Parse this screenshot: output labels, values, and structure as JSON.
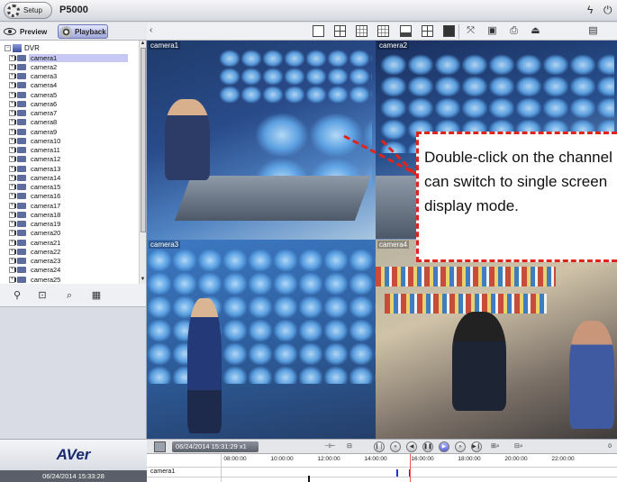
{
  "app": {
    "setup_label": "Setup",
    "title": "P5000",
    "title_icons": [
      "lightning-icon",
      "power-icon"
    ]
  },
  "modes": {
    "preview_label": "Preview",
    "playback_label": "Playback",
    "active": "Playback"
  },
  "toolbar": {
    "collapse_symbol": "‹",
    "tools": [
      "single-view",
      "quad-view",
      "nine-view",
      "sixteen-view",
      "one-plus-five-view",
      "one-plus-seven-view",
      "twenty-five-view",
      "fullscreen",
      "snapshot",
      "print",
      "backup",
      "exit"
    ]
  },
  "tree": {
    "root": "DVR",
    "selected": "camera1",
    "cameras": [
      "camera1",
      "camera2",
      "camera3",
      "camera4",
      "camera5",
      "camera6",
      "camera7",
      "camera8",
      "camera9",
      "camera10",
      "camera11",
      "camera12",
      "camera13",
      "camera14",
      "camera15",
      "camera16",
      "camera17",
      "camera18",
      "camera19",
      "camera20",
      "camera21",
      "camera22",
      "camera23",
      "camera24",
      "camera25"
    ]
  },
  "tree_tools": [
    "connect-icon",
    "export-icon",
    "search-icon",
    "playback-list-icon"
  ],
  "video": {
    "tiles": [
      "camera1",
      "camera2",
      "camera3",
      "camera4"
    ]
  },
  "callout": {
    "text": "Double-click on the channel can switch to single screen display mode.",
    "border_color": "#e0241b"
  },
  "playback": {
    "datetime": "06/24/2014 15:31:29 x1",
    "buttons": [
      "rewind-fast",
      "step-back",
      "reverse-play",
      "pause",
      "play",
      "forward",
      "step-forward"
    ],
    "active_button": "play"
  },
  "brand": {
    "logo": "AVer",
    "clock": "06/24/2014 15:33:28"
  },
  "timeline": {
    "ticks": [
      "08:00:00",
      "10:00:00",
      "12:00:00",
      "14:00:00",
      "16:00:00",
      "18:00:00",
      "20:00:00",
      "22:00:00"
    ],
    "row_label": "camera1",
    "end_label": "0"
  }
}
